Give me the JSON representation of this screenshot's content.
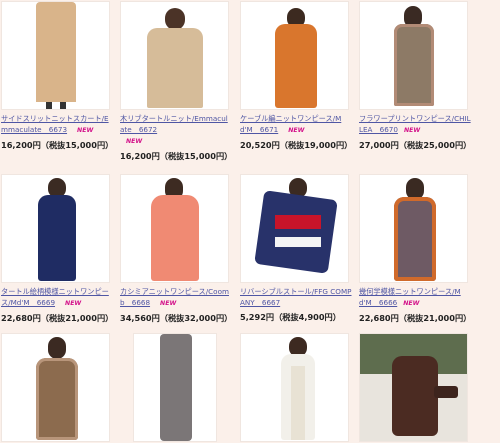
{
  "products": [
    {
      "caption": "サイドスリットニットスカート/Emmaculate　6673",
      "new": "NEW",
      "price": "16,200円（税抜15,000円）"
    },
    {
      "caption": "木リブタートルニット/Emmaculate　6672",
      "new": "NEW",
      "price": "16,200円（税抜15,000円）"
    },
    {
      "caption": "ケーブル編ニットワンピース/Md'M　6671",
      "new": "NEW",
      "price": "20,520円（税抜19,000円）"
    },
    {
      "caption": "フラワープリントワンピース/CHILLEA　6670",
      "new": "NEW",
      "price": "27,000円（税抜25,000円）"
    },
    {
      "caption": "タートル絵柄模様ニットワンピース/Md'M　6669",
      "new": "NEW",
      "price": "22,680円（税抜21,000円）"
    },
    {
      "caption": "カシミアニットワンピース/Coomb　6668",
      "new": "NEW",
      "price": "34,560円（税抜32,000円）"
    },
    {
      "caption": "リバーシブルストール/FFG COMPANY　6667",
      "new": "NEW",
      "price": "5,292円（税抜4,900円）"
    },
    {
      "caption": "幾何学模様ニットワンピース/Md'M　6666",
      "new": "NEW",
      "price": "22,680円（税抜21,000円）"
    }
  ],
  "colors": {
    "link": "#4f56a4",
    "new_badge": "#d3128a",
    "page_bg": "#fbf0ea"
  }
}
